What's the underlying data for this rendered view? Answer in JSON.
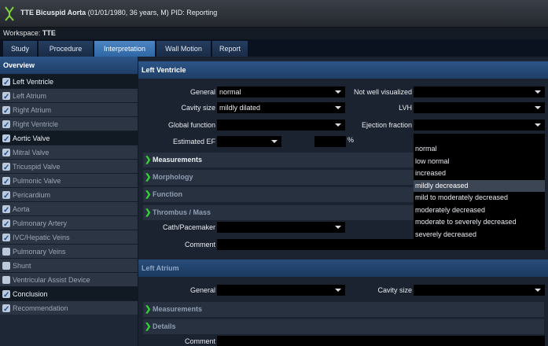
{
  "titlebar": {
    "study_name": "TTE Bicuspid Aorta",
    "patient_info": " (01/01/1980, 36 years, M) PID: Reporting"
  },
  "workspace": {
    "label": "Workspace: ",
    "value": "TTE"
  },
  "tabs": [
    {
      "label": "Study"
    },
    {
      "label": "Procedure"
    },
    {
      "label": "Interpretation"
    },
    {
      "label": "Wall Motion"
    },
    {
      "label": "Report"
    }
  ],
  "overview": {
    "header": "Overview",
    "items": [
      {
        "label": "Left Ventricle",
        "checked": true
      },
      {
        "label": "Left Atrium",
        "checked": true
      },
      {
        "label": "Right Atrium",
        "checked": true
      },
      {
        "label": "Right Ventricle",
        "checked": true
      },
      {
        "label": "Aortic Valve",
        "checked": true
      },
      {
        "label": "Mitral Valve",
        "checked": true
      },
      {
        "label": "Tricuspid Valve",
        "checked": true
      },
      {
        "label": "Pulmonic Valve",
        "checked": true
      },
      {
        "label": "Pericardium",
        "checked": true
      },
      {
        "label": "Aorta",
        "checked": true
      },
      {
        "label": "Pulmonary Artery",
        "checked": true
      },
      {
        "label": "IVC/Hepatic Veins",
        "checked": true
      },
      {
        "label": "Pulmonary Veins",
        "checked": false
      },
      {
        "label": "Shunt",
        "checked": false
      },
      {
        "label": "Ventricular Assist Device",
        "checked": false
      },
      {
        "label": "Conclusion",
        "checked": true
      },
      {
        "label": "Recommendation",
        "checked": true
      }
    ]
  },
  "left_ventricle": {
    "header": "Left Ventricle",
    "general_label": "General",
    "general_value": "normal",
    "not_well_visualized_label": "Not well visualized",
    "not_well_visualized_value": "",
    "cavity_size_label": "Cavity size",
    "cavity_size_value": "mildly dilated",
    "lvh_label": "LVH",
    "lvh_value": "",
    "global_function_label": "Global function",
    "global_function_value": "",
    "ejection_fraction_label": "Ejection fraction",
    "ejection_fraction_value": "",
    "estimated_ef_label": "Estimated EF",
    "estimated_ef_value": "",
    "percent_unit": "%",
    "measurements": "Measurements",
    "morphology": "Morphology",
    "function": "Function",
    "thrombus_mass": "Thrombus / Mass",
    "cath_pacemaker_label": "Cath/Pacemaker",
    "cath_pacemaker_value": "",
    "comment_label": "Comment"
  },
  "ejection_fraction_dropdown": {
    "options": [
      "normal",
      "low normal",
      "increased",
      "mildly decreased",
      "mild to moderately decreased",
      "moderately decreased",
      "moderate to severely decreased",
      "severely decreased"
    ],
    "highlighted": "mildly decreased"
  },
  "left_atrium": {
    "header": "Left Atrium",
    "general_label": "General",
    "general_value": "",
    "cavity_size_label": "Cavity size",
    "cavity_size_value": "",
    "measurements": "Measurements",
    "details": "Details",
    "comment_label": "Comment"
  },
  "colors": {
    "active_tab": "#3f79b8",
    "header_blue": "#2a5080",
    "chevron_green": "#38d23a",
    "background": "#0b1a2c"
  }
}
